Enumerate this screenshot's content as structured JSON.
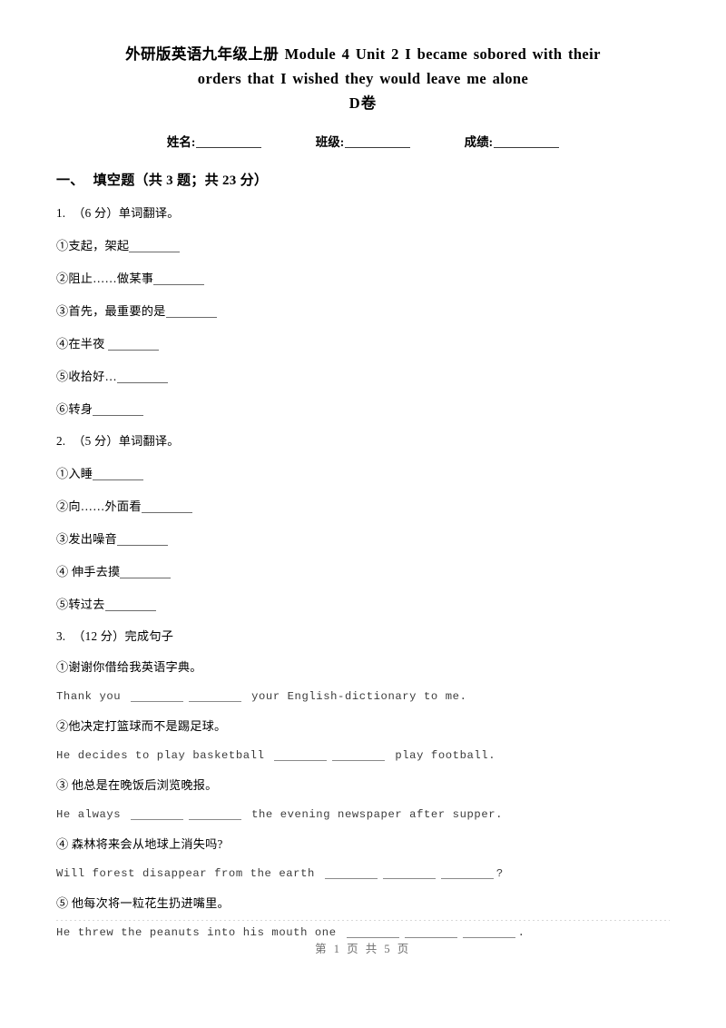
{
  "title": {
    "line1": "外研版英语九年级上册 Module 4 Unit 2 I became sobored with their",
    "line2": "orders that I wished they would leave me alone",
    "line3": "D卷"
  },
  "student_info": {
    "name_label": "姓名:",
    "class_label": "班级:",
    "score_label": "成绩:"
  },
  "section": {
    "number": "一、",
    "title": "填空题（共 3 题；共 23 分）"
  },
  "questions": [
    {
      "number": "1.",
      "stem": "（6 分）单词翻译。",
      "items": [
        {
          "text": "①支起，架起"
        },
        {
          "text": "②阻止……做某事"
        },
        {
          "text": "③首先，最重要的是"
        },
        {
          "text": "④在半夜 "
        },
        {
          "text": "⑤收拾好…"
        },
        {
          "text": "⑥转身"
        }
      ]
    },
    {
      "number": "2.",
      "stem": "（5 分）单词翻译。",
      "items": [
        {
          "text": "①入睡"
        },
        {
          "text": "②向……外面看"
        },
        {
          "text": "③发出噪音"
        },
        {
          "text": "④ 伸手去摸"
        },
        {
          "text": "⑤转过去"
        }
      ]
    },
    {
      "number": "3.",
      "stem": "（12 分）完成句子",
      "sentences": [
        {
          "prompt": "①谢谢你借给我英语字典。",
          "en_before": "Thank you",
          "en_mid": "",
          "en_after": "your English-dictionary to me.",
          "blanks": 2
        },
        {
          "prompt": "②他决定打篮球而不是踢足球。",
          "en_before": "He decides to play basketball",
          "en_mid": "",
          "en_after": "play football.",
          "blanks": 2
        },
        {
          "prompt": "③ 他总是在晚饭后浏览晚报。",
          "en_before": "He always",
          "en_mid": "",
          "en_after": "the evening newspaper after supper.",
          "blanks": 2
        },
        {
          "prompt": "④ 森林将来会从地球上消失吗?",
          "en_before": "Will forest disappear from the earth",
          "en_mid": "",
          "en_after": "?",
          "blanks": 3
        },
        {
          "prompt": "⑤ 他每次将一粒花生扔进嘴里。",
          "en_before": "He threw the peanuts into his mouth one",
          "en_mid": "",
          "en_after": ".",
          "blanks": 3
        }
      ]
    }
  ],
  "footer": {
    "text": "第 1 页 共 5 页"
  }
}
